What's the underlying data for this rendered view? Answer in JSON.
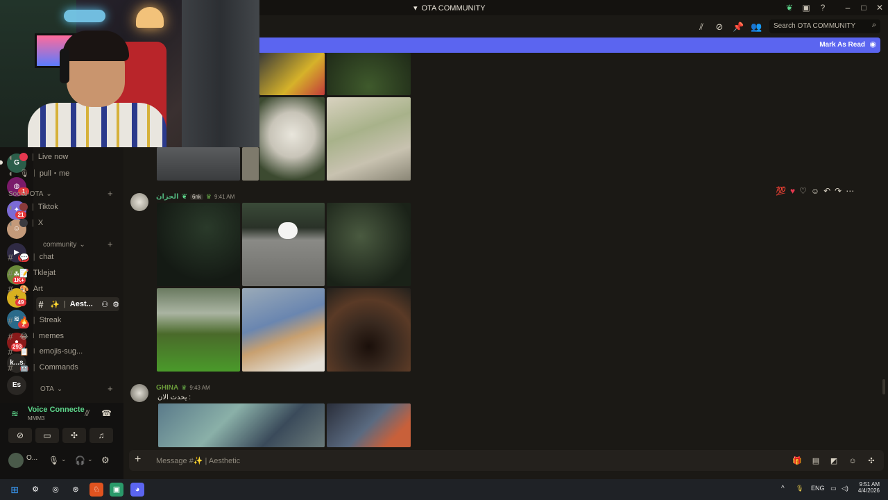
{
  "window": {
    "title": "OTA COMMUNITY"
  },
  "header": {
    "search_placeholder": "Search OTA COMMUNITY"
  },
  "new_messages_bar": {
    "action_label": "Mark As Read"
  },
  "servers": [
    {
      "badge": ""
    },
    {
      "badge": "1"
    },
    {
      "badge": "21"
    },
    {
      "badge": ""
    },
    {
      "badge": "5"
    },
    {
      "badge": "1K+"
    },
    {
      "badge": "49"
    },
    {
      "badge": "2"
    },
    {
      "badge": "293"
    },
    {
      "label": "k...s"
    },
    {
      "label": "Es"
    }
  ],
  "channels": {
    "voice": [
      {
        "name": "Live now"
      },
      {
        "name": "pull・me"
      }
    ],
    "social_category": "Social-OTA",
    "social": [
      {
        "name": "Tiktok"
      },
      {
        "name": "X"
      }
    ],
    "community_category": "community",
    "community": [
      {
        "name": "chat"
      },
      {
        "name": "Tklejat"
      },
      {
        "name": "Art"
      },
      {
        "name": "Aest..."
      },
      {
        "name": "Streak"
      },
      {
        "name": "memes"
      },
      {
        "name": "emojis-sug..."
      },
      {
        "name": "Commands"
      }
    ],
    "ota_category": "OTA"
  },
  "voice_panel": {
    "status": "Voice Connecte",
    "channel": "MMM3"
  },
  "user_panel": {
    "name": "O..."
  },
  "messages": [
    {
      "username": "الحزان",
      "boost": "6nk",
      "time": "9:41 AM"
    },
    {
      "username": "GHINA",
      "time": "9:43 AM",
      "text": "يحدث الان :"
    }
  ],
  "composer": {
    "placeholder": "Message #✨ | Aesthetic"
  },
  "taskbar": {
    "lang": "ENG",
    "time": "9:51 AM",
    "date": "4/4/2026"
  },
  "colors": {
    "accent": "#5b65f0",
    "voice_green": "#5dd68b",
    "badge_red": "#e5383b"
  }
}
